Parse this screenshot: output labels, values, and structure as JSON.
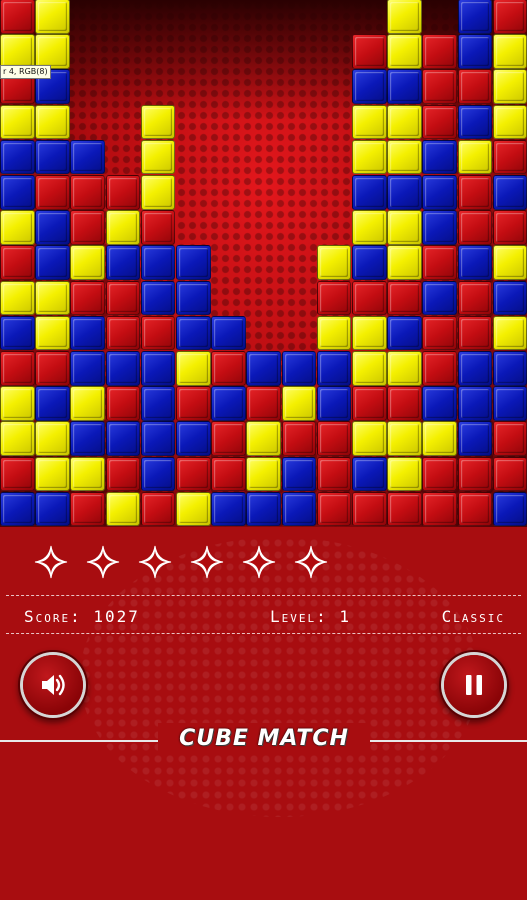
{
  "board": {
    "columns": [
      [
        "b",
        "r",
        "y",
        "y",
        "r",
        "b",
        "y",
        "r",
        "y",
        "b",
        "b",
        "y",
        "r",
        "y",
        "r"
      ],
      [
        "b",
        "y",
        "y",
        "b",
        "r",
        "y",
        "y",
        "b",
        "b",
        "r",
        "b",
        "y",
        "b",
        "y",
        "y"
      ],
      [
        "r",
        "y",
        "b",
        "y",
        "b",
        "b",
        "r",
        "y",
        "r",
        "r",
        "b"
      ],
      [
        "y",
        "r",
        "b",
        "r",
        "b",
        "r",
        "r",
        "b",
        "y",
        "r"
      ],
      [
        "r",
        "b",
        "b",
        "b",
        "b",
        "r",
        "b",
        "b",
        "r",
        "y",
        "y",
        "y"
      ],
      [
        "y",
        "r",
        "b",
        "r",
        "y",
        "b",
        "b",
        "b"
      ],
      [
        "b",
        "r",
        "r",
        "b",
        "r",
        "b"
      ],
      [
        "b",
        "y",
        "y",
        "r",
        "b"
      ],
      [
        "b",
        "b",
        "r",
        "y",
        "b"
      ],
      [
        "r",
        "r",
        "r",
        "b",
        "b",
        "y",
        "r",
        "y"
      ],
      [
        "r",
        "b",
        "y",
        "r",
        "y",
        "y",
        "r",
        "b",
        "y",
        "b",
        "y",
        "y",
        "b",
        "r"
      ],
      [
        "r",
        "y",
        "y",
        "r",
        "y",
        "b",
        "r",
        "y",
        "y",
        "b",
        "y",
        "y",
        "b",
        "y",
        "y"
      ],
      [
        "r",
        "r",
        "y",
        "b",
        "r",
        "r",
        "b",
        "r",
        "b",
        "b",
        "b",
        "r",
        "r",
        "r"
      ],
      [
        "r",
        "r",
        "b",
        "b",
        "b",
        "r",
        "r",
        "b",
        "r",
        "r",
        "y",
        "b",
        "r",
        "b",
        "b"
      ],
      [
        "b",
        "r",
        "r",
        "b",
        "b",
        "y",
        "b",
        "y",
        "r",
        "b",
        "r",
        "y",
        "y",
        "y",
        "r"
      ]
    ]
  },
  "tooltip_text": "r 4, RGB(8)",
  "stars": {
    "count": 6,
    "icon": "four-point-star-icon"
  },
  "hud": {
    "score_label": "Score:",
    "score_value": "1027",
    "level_label": "Level:",
    "level_value": "1",
    "mode": "Classic"
  },
  "buttons": {
    "sound": {
      "icon": "speaker-icon"
    },
    "pause": {
      "icon": "pause-icon"
    }
  },
  "logo": {
    "text": "CUBE MATCH"
  },
  "colors": {
    "yellow": "#f4f000",
    "red": "#c40d12",
    "blue": "#0a18b8",
    "panel": "#a80d10"
  }
}
